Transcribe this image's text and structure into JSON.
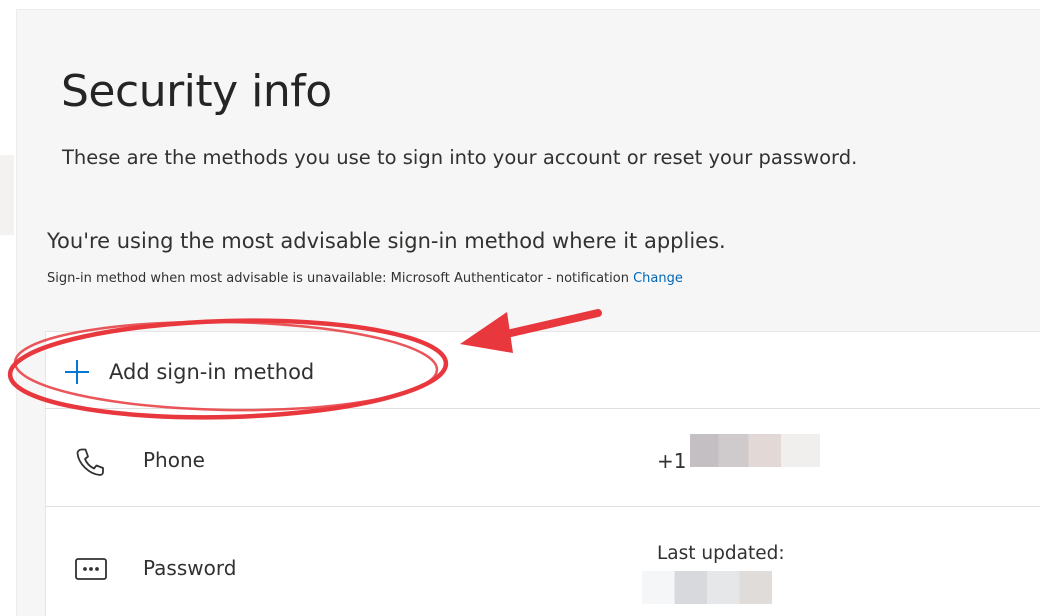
{
  "page": {
    "title": "Security info",
    "subtitle": "These are the methods you use to sign into your account or reset your password.",
    "advisable_text": "You're using the most advisable sign-in method where it applies.",
    "fallback_text": "Sign-in method when most advisable is unavailable: Microsoft Authenticator - notification",
    "change_link": "Change"
  },
  "add_method": {
    "label": "Add sign-in method",
    "icon": "plus-icon"
  },
  "methods": [
    {
      "name": "Phone",
      "icon": "phone-icon",
      "value": "+1",
      "value_redacted": true
    },
    {
      "name": "Password",
      "icon": "password-icon",
      "detail_label": "Last updated:",
      "detail_redacted": true
    }
  ],
  "colors": {
    "accent": "#0078d4",
    "link": "#0067b8",
    "annotation": "#e8383d",
    "panel_bg": "#f6f6f6",
    "card_bg": "#ffffff"
  }
}
